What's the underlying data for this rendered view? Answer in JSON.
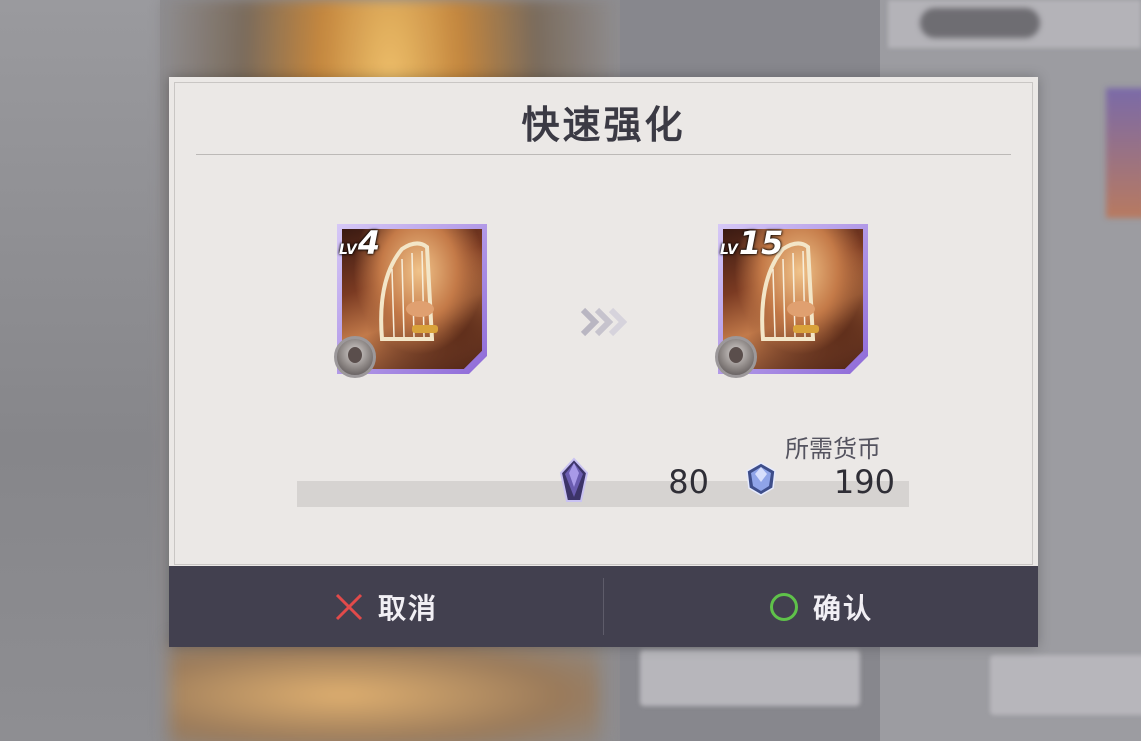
{
  "dialog": {
    "title": "快速强化",
    "from_card": {
      "level_prefix": "LV",
      "level": "4",
      "name_icon": "harp-character-card-icon"
    },
    "to_card": {
      "level_prefix": "LV",
      "level": "15",
      "name_icon": "harp-character-card-icon"
    },
    "arrow_icon": "double-chevron-right-icon",
    "currency": {
      "label": "所需货币",
      "slider_level": 0.44,
      "crystal_icon": "purple-crystal-icon",
      "crystal_amount": "80",
      "gem_icon": "blue-gem-icon",
      "gem_amount": "190"
    },
    "footer": {
      "cancel_label": "取消",
      "confirm_label": "确认"
    },
    "colors": {
      "cancel_icon": "#e24a4a",
      "confirm_icon": "#5fc24a",
      "card_frame": "#8e6ad8"
    }
  }
}
